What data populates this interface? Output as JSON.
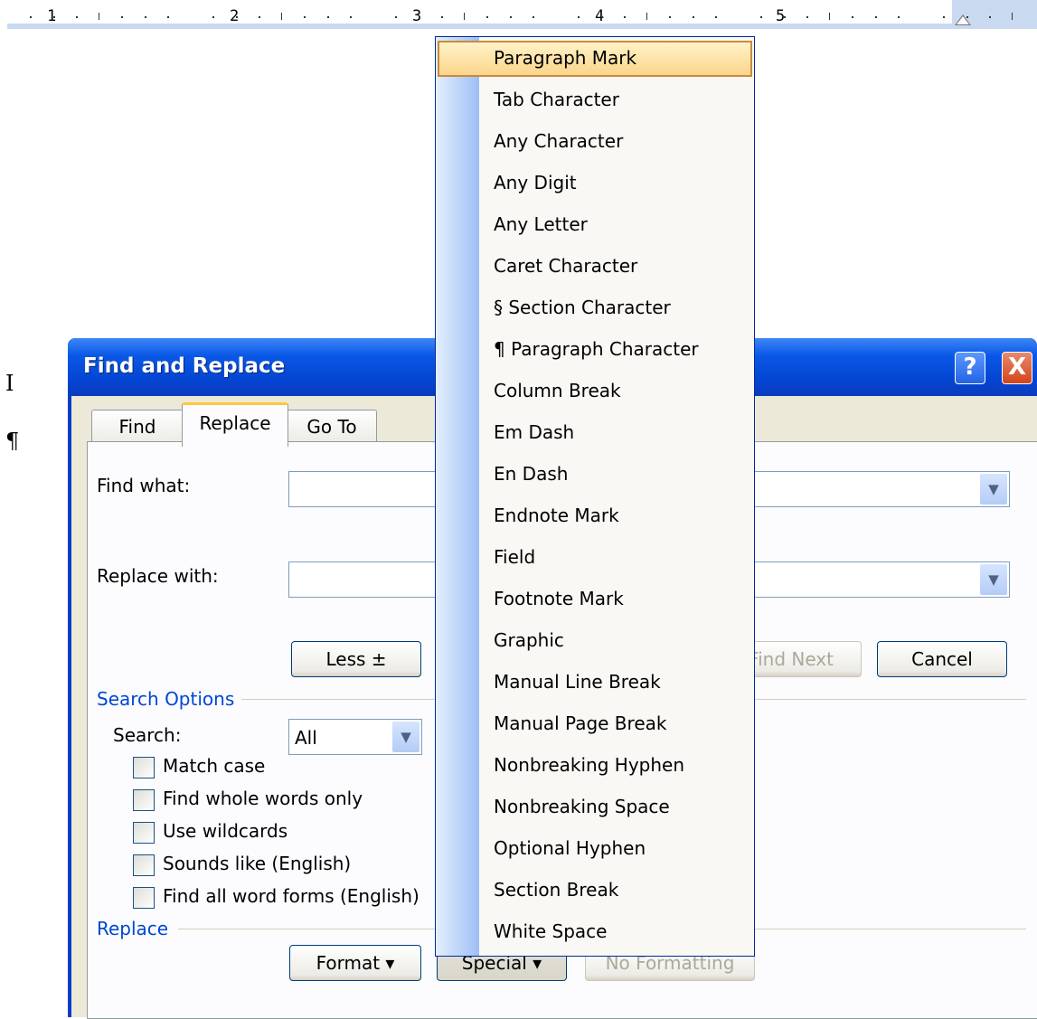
{
  "ruler": {
    "numbers": [
      "1",
      "2",
      "3",
      "4",
      "5"
    ]
  },
  "document": {
    "marks": [
      "I",
      "¶"
    ]
  },
  "dialog": {
    "title": "Find and Replace",
    "help_label": "?",
    "close_label": "X",
    "tabs": [
      {
        "label": "Find",
        "active": false
      },
      {
        "label": "Replace",
        "active": true
      },
      {
        "label": "Go To",
        "active": false
      }
    ],
    "find_what_label": "Find what:",
    "find_what_value": "",
    "replace_with_label": "Replace with:",
    "replace_with_value": "",
    "less_button": "Less ±",
    "find_next_button": "Find Next",
    "cancel_button": "Cancel",
    "search_options_label": "Search Options",
    "search_label": "Search:",
    "search_value": "All",
    "options": [
      {
        "label": "Match case",
        "checked": false
      },
      {
        "label": "Find whole words only",
        "checked": false
      },
      {
        "label": "Use wildcards",
        "checked": false
      },
      {
        "label": "Sounds like (English)",
        "checked": false
      },
      {
        "label": "Find all word forms (English)",
        "checked": false
      }
    ],
    "replace_section_label": "Replace",
    "format_button": "Format ▾",
    "special_button": "Special ▾",
    "no_formatting_button": "No Formatting"
  },
  "special_menu": {
    "highlighted_index": 0,
    "items": [
      "Paragraph Mark",
      "Tab Character",
      "Any Character",
      "Any Digit",
      "Any Letter",
      "Caret Character",
      "§ Section Character",
      "¶ Paragraph Character",
      "Column Break",
      "Em Dash",
      "En Dash",
      "Endnote Mark",
      "Field",
      "Footnote Mark",
      "Graphic",
      "Manual Line Break",
      "Manual Page Break",
      "Nonbreaking Hyphen",
      "Nonbreaking Space",
      "Optional Hyphen",
      "Section Break",
      "White Space"
    ]
  }
}
